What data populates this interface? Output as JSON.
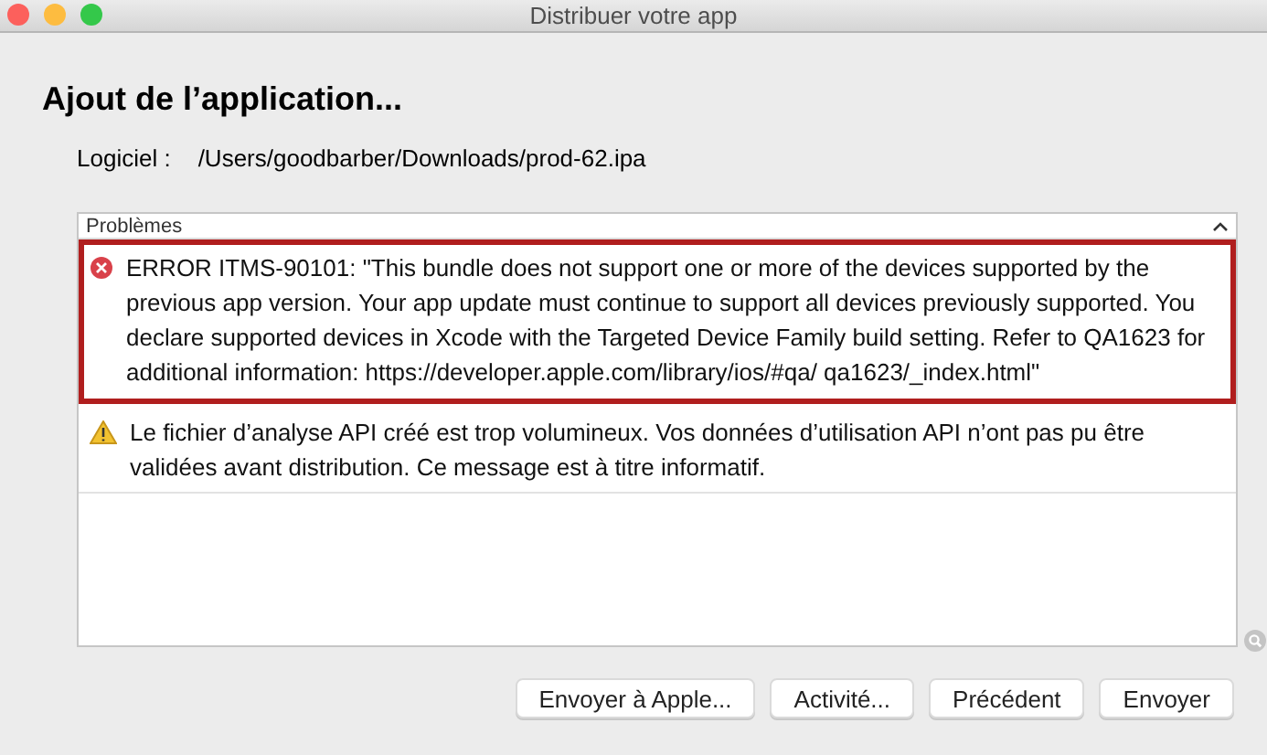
{
  "window": {
    "title": "Distribuer votre app"
  },
  "heading": "Ajout de l’application...",
  "software": {
    "label": "Logiciel :",
    "value": "/Users/goodbarber/Downloads/prod-62.ipa"
  },
  "problems": {
    "title": "Problèmes",
    "expanded": true,
    "items": [
      {
        "kind": "error",
        "highlighted": true,
        "text": "ERROR ITMS-90101: \"This bundle does not support one or more of the devices supported by the previous app version. Your app update must continue to support all devices previously supported. You declare supported devices in Xcode with the Targeted Device Family build setting. Refer to QA1623 for additional information: https://developer.apple.com/library/ios/#qa/ qa1623/_index.html\""
      },
      {
        "kind": "warning",
        "highlighted": false,
        "text": "Le fichier d’analyse API créé est trop volumineux. Vos données d’utilisation API n’ont pas pu être validées avant distribution. Ce message est à titre informatif."
      }
    ]
  },
  "buttons": [
    "Envoyer à Apple...",
    "Activité...",
    "Précédent",
    "Envoyer"
  ]
}
